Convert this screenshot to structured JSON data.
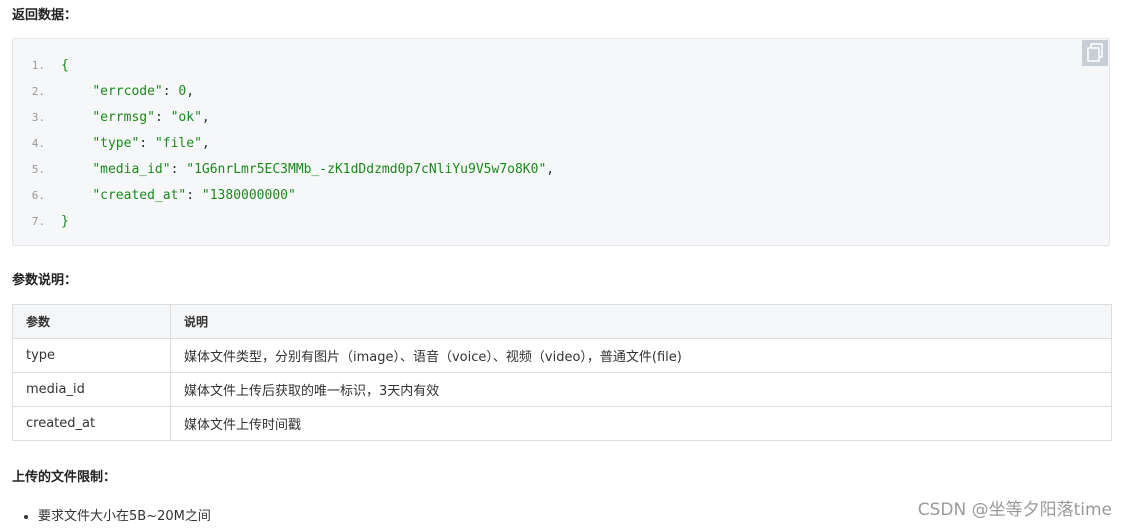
{
  "sections": {
    "return_data_title": "返回数据：",
    "params_title": "参数说明：",
    "limits_title": "上传的文件限制："
  },
  "code": {
    "lines": [
      {
        "no": "1.",
        "text": "{"
      },
      {
        "no": "2.",
        "key": "\"errcode\"",
        "sep": ": ",
        "value": "0",
        "trail": ","
      },
      {
        "no": "3.",
        "key": "\"errmsg\"",
        "sep": ": ",
        "value": "\"ok\"",
        "trail": ","
      },
      {
        "no": "4.",
        "key": "\"type\"",
        "sep": ": ",
        "value": "\"file\"",
        "trail": ","
      },
      {
        "no": "5.",
        "key": "\"media_id\"",
        "sep": ": ",
        "value": "\"1G6nrLmr5EC3MMb_-zK1dDdzmd0p7cNliYu9V5w7o8K0\"",
        "trail": ","
      },
      {
        "no": "6.",
        "key": "\"created_at\"",
        "sep": ": ",
        "value": "\"1380000000\"",
        "trail": ""
      },
      {
        "no": "7.",
        "text": "}"
      }
    ],
    "copy_icon": "copy-icon"
  },
  "params_table": {
    "headers": [
      "参数",
      "说明"
    ],
    "rows": [
      [
        "type",
        "媒体文件类型，分别有图片（image）、语音（voice）、视频（video），普通文件(file)"
      ],
      [
        "media_id",
        "媒体文件上传后获取的唯一标识，3天内有效"
      ],
      [
        "created_at",
        "媒体文件上传时间戳"
      ]
    ]
  },
  "limits": {
    "items": [
      "要求文件大小在5B~20M之间"
    ]
  },
  "watermark": "CSDN @坐等夕阳落time"
}
